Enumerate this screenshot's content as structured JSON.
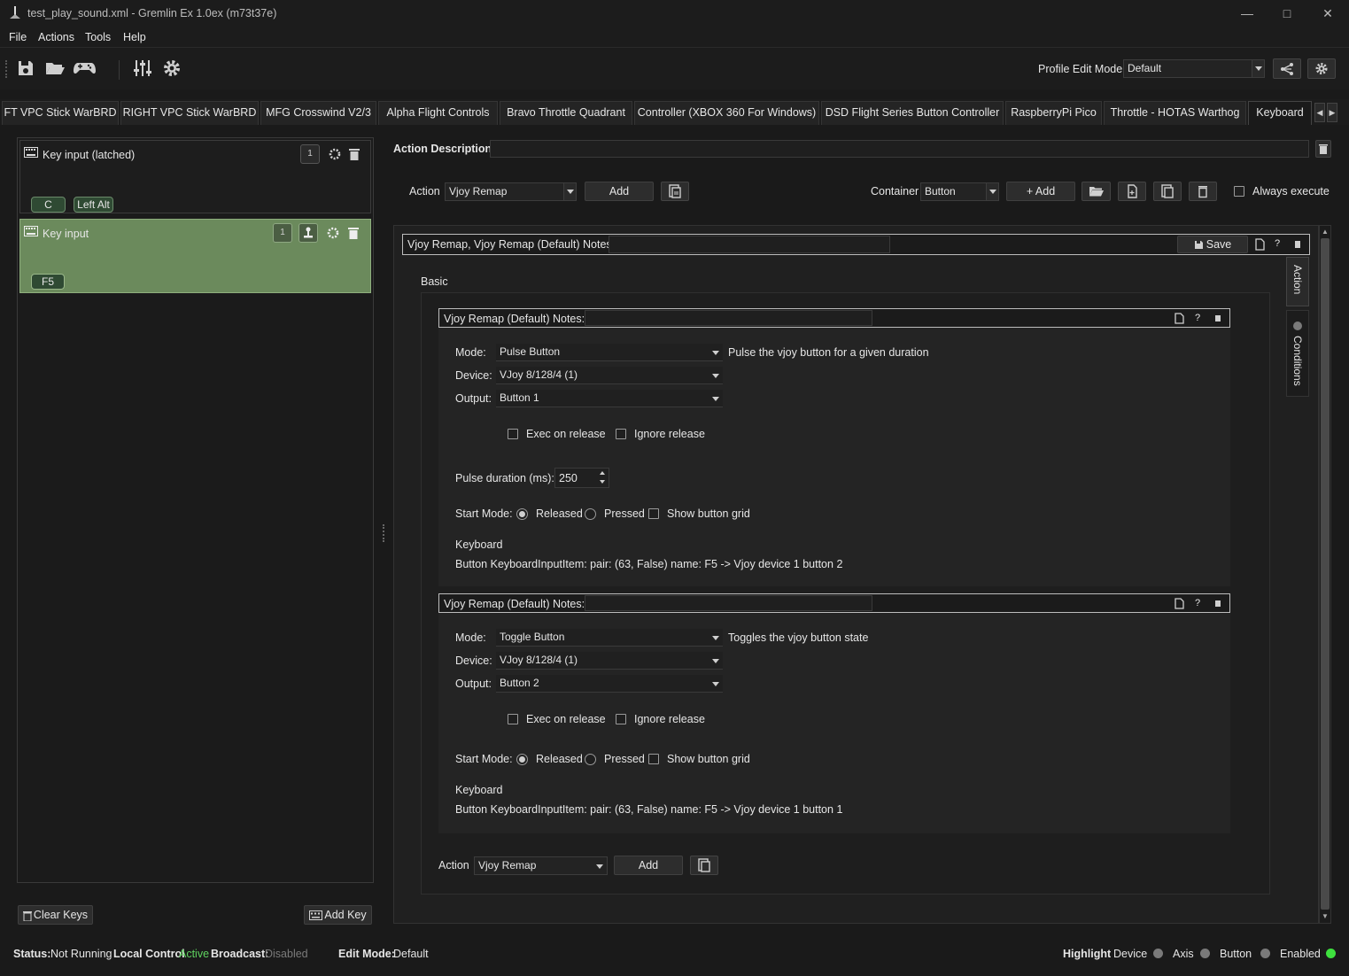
{
  "window": {
    "title": "test_play_sound.xml - Gremlin Ex 1.0ex (m73t37e)"
  },
  "menu": [
    "File",
    "Actions",
    "Tools",
    "Help"
  ],
  "toolbar": {
    "profile_edit_mode_label": "Profile Edit Mode",
    "profile_edit_mode_value": "Default"
  },
  "tabs": [
    "FT VPC Stick WarBRD",
    "RIGHT VPC Stick WarBRD",
    "MFG Crosswind V2/3",
    "Alpha Flight Controls",
    "Bravo Throttle Quadrant",
    "Controller (XBOX 360 For Windows)",
    "DSD Flight Series Button Controller",
    "RaspberryPi Pico",
    "Throttle - HOTAS Warthog",
    "Keyboard"
  ],
  "inputs": [
    {
      "label": "Key input (latched)",
      "count": "1",
      "keys": [
        "C",
        "Left Alt"
      ],
      "selected": false
    },
    {
      "label": "Key input",
      "count": "1",
      "keys": [
        "F5"
      ],
      "selected": true
    }
  ],
  "left_footer": {
    "clear_keys": "Clear Keys",
    "add_key": "Add Key"
  },
  "action_description_label": "Action Description",
  "action_row": {
    "action_label": "Action",
    "action_value": "Vjoy Remap",
    "add_label": "Add",
    "container_label": "Container",
    "container_value": "Button",
    "container_add": "+ Add",
    "always_execute": "Always execute"
  },
  "container": {
    "title": "Vjoy Remap, Vjoy Remap (Default)  Notes:",
    "save_label": "Save",
    "help": "?",
    "basic_label": "Basic",
    "side_tabs": [
      "Action",
      "Conditions"
    ]
  },
  "remaps": [
    {
      "title": "Vjoy Remap (Default)  Notes:",
      "mode_label": "Mode:",
      "mode": "Pulse Button",
      "mode_desc": "Pulse the vjoy button for a given duration",
      "device_label": "Device:",
      "device": "VJoy 8/128/4 (1)",
      "output_label": "Output:",
      "output": "Button 1",
      "exec_on_release": "Exec on release",
      "ignore_release": "Ignore release",
      "pulse_label": "Pulse duration (ms):",
      "pulse_value": "250",
      "start_mode_label": "Start Mode:",
      "released": "Released",
      "pressed": "Pressed",
      "show_grid": "Show button grid",
      "kb_title": "Keyboard",
      "kb_desc": "Button KeyboardInputItem: pair: (63, False) name: F5 -> Vjoy device 1 button 2"
    },
    {
      "title": "Vjoy Remap (Default)  Notes:",
      "mode_label": "Mode:",
      "mode": "Toggle Button",
      "mode_desc": "Toggles the vjoy button state",
      "device_label": "Device:",
      "device": "VJoy 8/128/4 (1)",
      "output_label": "Output:",
      "output": "Button 2",
      "exec_on_release": "Exec on release",
      "ignore_release": "Ignore release",
      "start_mode_label": "Start Mode:",
      "released": "Released",
      "pressed": "Pressed",
      "show_grid": "Show button grid",
      "kb_title": "Keyboard",
      "kb_desc": "Button KeyboardInputItem: pair: (63, False) name: F5 -> Vjoy device 1 button 1"
    }
  ],
  "bottom_action": {
    "label": "Action",
    "value": "Vjoy Remap",
    "add": "Add"
  },
  "status": {
    "status_label": "Status:",
    "status_value": "Not Running",
    "local_label": "Local Control",
    "local_value": "Active",
    "broadcast_label": "Broadcast:",
    "broadcast_value": "Disabled",
    "edit_mode_label": "Edit Mode:",
    "edit_mode_value": "Default",
    "highlight_label": "Highlight",
    "device": "Device",
    "axis": "Axis",
    "button": "Button",
    "enabled": "Enabled",
    "colors": {
      "active": "#5fd35f",
      "disabled": "#7a7a7a",
      "enabled_dot": "#3ee03e"
    }
  }
}
